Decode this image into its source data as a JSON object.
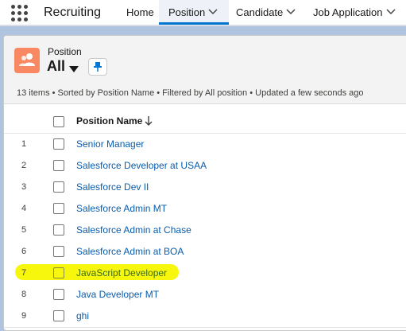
{
  "app": {
    "name": "Recruiting"
  },
  "nav": {
    "home": "Home",
    "position": "Position",
    "candidate": "Candidate",
    "job_application": "Job Application"
  },
  "colors": {
    "accent": "#0176d3",
    "object_icon": "#f88962",
    "link": "#0b5cab",
    "highlight": "#f7f700"
  },
  "list_view": {
    "object_label": "Position",
    "view_name": "All",
    "info": "13 items • Sorted by Position Name • Filtered by All position • Updated a few seconds ago",
    "column_header": "Position Name"
  },
  "rows": [
    {
      "num": "1",
      "name": "Senior Manager"
    },
    {
      "num": "2",
      "name": "Salesforce Developer at USAA"
    },
    {
      "num": "3",
      "name": "Salesforce Dev II"
    },
    {
      "num": "4",
      "name": "Salesforce Admin MT"
    },
    {
      "num": "5",
      "name": "Salesforce Admin at Chase"
    },
    {
      "num": "6",
      "name": "Salesforce Admin at BOA"
    },
    {
      "num": "7",
      "name": "JavaScript Developer",
      "highlighted": true
    },
    {
      "num": "8",
      "name": "Java Developer MT"
    },
    {
      "num": "9",
      "name": "ghi"
    }
  ]
}
